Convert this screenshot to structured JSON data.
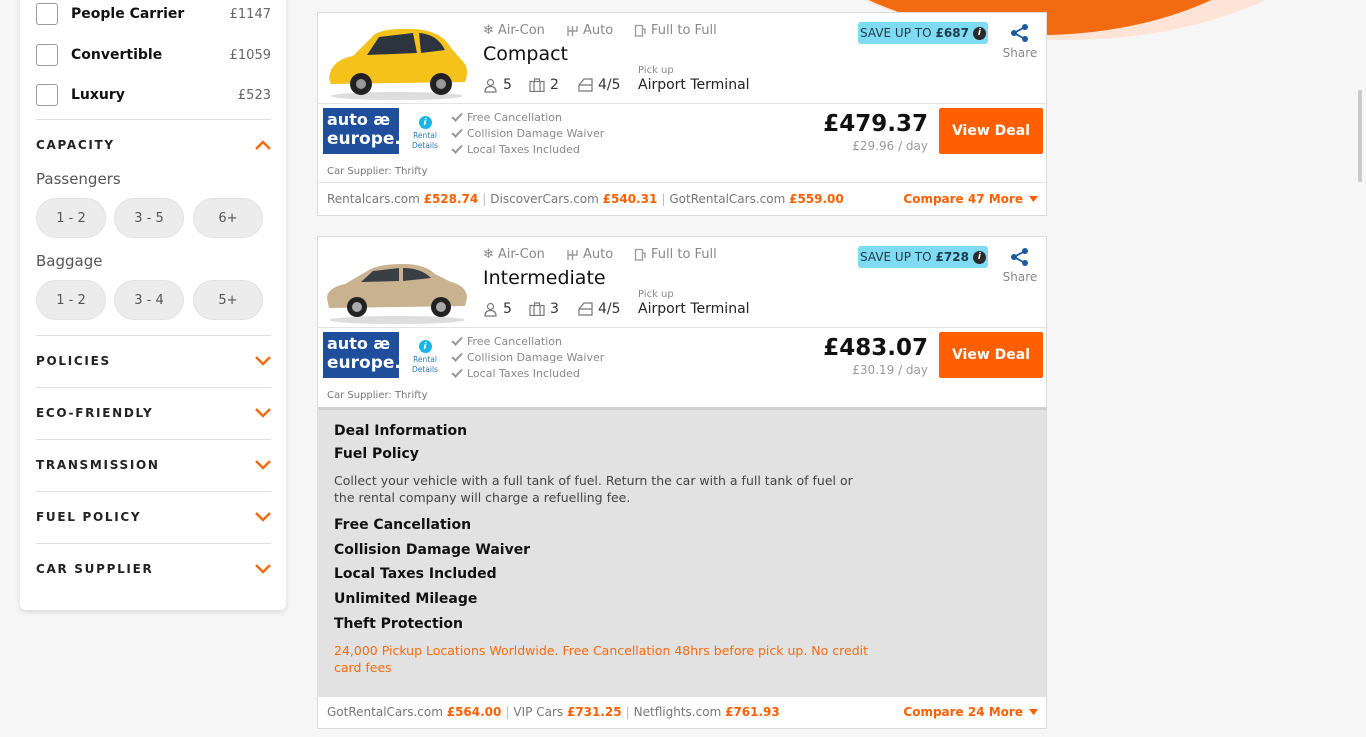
{
  "colors": {
    "accent": "#ff5f00",
    "badge": "#7fdbf2",
    "brand_logo": "#1f4f9c"
  },
  "sidebar": {
    "car_types": [
      {
        "label": "People Carrier",
        "price": "£1147"
      },
      {
        "label": "Convertible",
        "price": "£1059"
      },
      {
        "label": "Luxury",
        "price": "£523"
      }
    ],
    "capacity": {
      "title": "CAPACITY",
      "passengers_label": "Passengers",
      "passengers": [
        "1 - 2",
        "3 - 5",
        "6+"
      ],
      "baggage_label": "Baggage",
      "baggage": [
        "1 - 2",
        "3 - 4",
        "5+"
      ]
    },
    "sections": [
      "POLICIES",
      "ECO-FRIENDLY",
      "TRANSMISSION",
      "FUEL POLICY",
      "CAR SUPPLIER"
    ]
  },
  "cards": [
    {
      "ac": "Air-Con",
      "gear": "Auto",
      "fuel": "Full to Full",
      "name": "Compact",
      "passengers": "5",
      "bags": "2",
      "doors": "4/5",
      "pickup_label": "Pick up",
      "pickup": "Airport Terminal",
      "save_prefix": "SAVE UP TO",
      "save_amount": "£687",
      "share": "Share",
      "logo_line1": "auto æ",
      "logo_line2": "europe.",
      "rental_details": [
        "Rental",
        "Details"
      ],
      "inclusions": [
        "Free Cancellation",
        "Collision Damage Waiver",
        "Local Taxes Included"
      ],
      "price": "£479.37",
      "per_day": "£29.96 / day",
      "cta": "View Deal",
      "supplier": "Car Supplier: Thrifty",
      "compare": [
        {
          "site": "Rentalcars.com",
          "price": "£528.74"
        },
        {
          "site": "DiscoverCars.com",
          "price": "£540.31"
        },
        {
          "site": "GotRentalCars.com",
          "price": "£559.00"
        }
      ],
      "compare_more": "Compare 47 More",
      "car_color": "#f5c21b"
    },
    {
      "ac": "Air-Con",
      "gear": "Auto",
      "fuel": "Full to Full",
      "name": "Intermediate",
      "passengers": "5",
      "bags": "3",
      "doors": "4/5",
      "pickup_label": "Pick up",
      "pickup": "Airport Terminal",
      "save_prefix": "SAVE UP TO",
      "save_amount": "£728",
      "share": "Share",
      "logo_line1": "auto æ",
      "logo_line2": "europe.",
      "rental_details": [
        "Rental",
        "Details"
      ],
      "inclusions": [
        "Free Cancellation",
        "Collision Damage Waiver",
        "Local Taxes Included"
      ],
      "price": "£483.07",
      "per_day": "£30.19 / day",
      "cta": "View Deal",
      "supplier": "Car Supplier: Thrifty",
      "deal": {
        "title": "Deal Information",
        "fuel_title": "Fuel Policy",
        "fuel_text": "Collect your vehicle with a full tank of fuel. Return the car with a full tank of fuel or the rental company will charge a refuelling fee.",
        "items": [
          "Free Cancellation",
          "Collision Damage Waiver",
          "Local Taxes Included",
          "Unlimited Mileage",
          "Theft Protection"
        ],
        "note": "24,000 Pickup Locations Worldwide. Free Cancellation 48hrs before pick up. No credit card fees"
      },
      "compare": [
        {
          "site": "GotRentalCars.com",
          "price": "£564.00"
        },
        {
          "site": "VIP Cars",
          "price": "£731.25"
        },
        {
          "site": "Netflights.com",
          "price": "£761.93"
        }
      ],
      "compare_more": "Compare 24 More",
      "car_color": "#c8b28f"
    }
  ]
}
